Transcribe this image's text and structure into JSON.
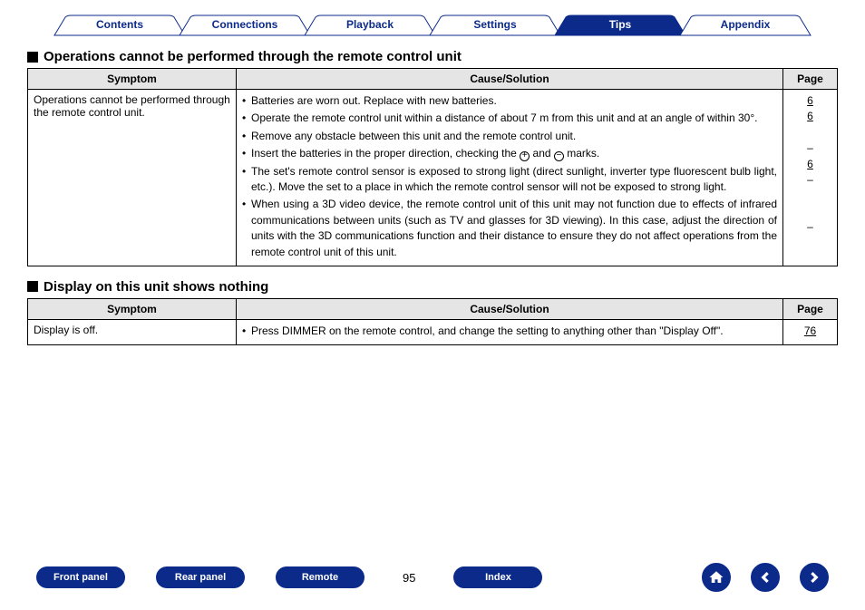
{
  "tabs": [
    {
      "label": "Contents",
      "active": false
    },
    {
      "label": "Connections",
      "active": false
    },
    {
      "label": "Playback",
      "active": false
    },
    {
      "label": "Settings",
      "active": false
    },
    {
      "label": "Tips",
      "active": true
    },
    {
      "label": "Appendix",
      "active": false
    }
  ],
  "section1": {
    "title": "Operations cannot be performed through the remote control unit",
    "headers": {
      "symptom": "Symptom",
      "cause": "Cause/Solution",
      "page": "Page"
    },
    "symptom": "Operations cannot be performed through the remote control unit.",
    "causes": [
      "Batteries are worn out. Replace with new batteries.",
      "Operate the remote control unit within a distance of about 7 m from this unit and at an angle of within 30°.",
      "Remove any obstacle between this unit and the remote control unit.",
      {
        "pre": "Insert the batteries in the proper direction, checking the ",
        "post": " marks."
      },
      "The set's remote control sensor is exposed to strong light (direct sunlight, inverter type fluorescent bulb light, etc.). Move the set to a place in which the remote control sensor will not be exposed to strong light.",
      "When using a 3D video device, the remote control unit of this unit may not function due to effects of infrared communications between units (such as TV and glasses for 3D viewing). In this case, adjust the direction of units with the 3D communications function and their distance to ensure they do not affect operations from the remote control unit of this unit."
    ],
    "pages": [
      "6",
      "6",
      "–",
      "6",
      "–",
      "–"
    ]
  },
  "section2": {
    "title": "Display on this unit shows nothing",
    "headers": {
      "symptom": "Symptom",
      "cause": "Cause/Solution",
      "page": "Page"
    },
    "symptom": "Display is off.",
    "cause": "Press DIMMER on the remote control, and change the setting to anything other than \"Display Off\".",
    "page": "76"
  },
  "bottom": {
    "buttons": {
      "front": "Front panel",
      "rear": "Rear panel",
      "remote": "Remote",
      "index": "Index"
    },
    "page_number": "95"
  },
  "icons": {
    "plus": "+",
    "minus": "−",
    "and": " and "
  }
}
